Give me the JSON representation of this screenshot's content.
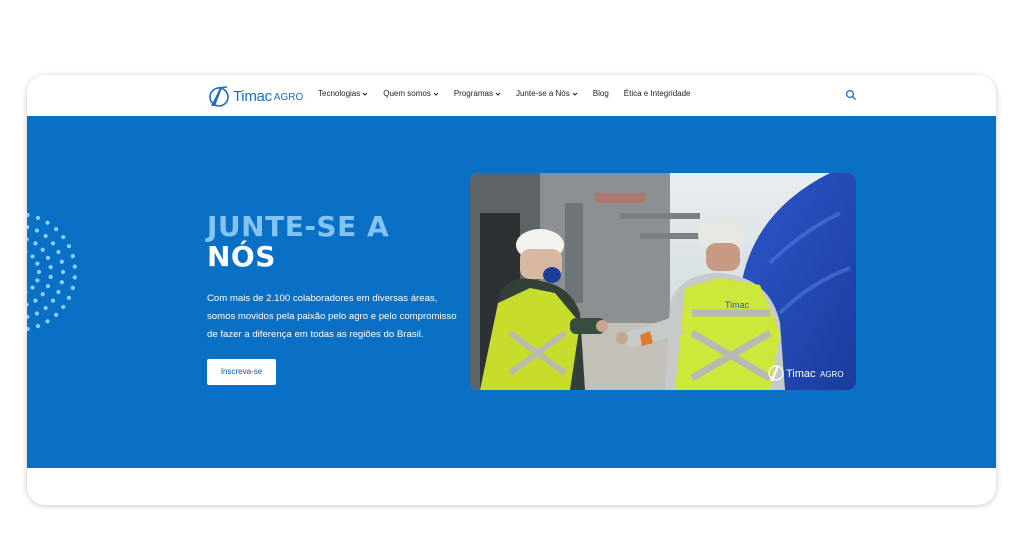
{
  "brand": {
    "name": "Timac",
    "sub": "AGRO",
    "color": "#1a6cc4"
  },
  "nav": {
    "items": [
      {
        "label": "Tecnologias",
        "dropdown": true
      },
      {
        "label": "Quem somos",
        "dropdown": true
      },
      {
        "label": "Programas",
        "dropdown": true
      },
      {
        "label": "Junte-se a Nós",
        "dropdown": true
      },
      {
        "label": "Blog",
        "dropdown": false
      },
      {
        "label": "Ética e Integridade",
        "dropdown": false
      }
    ],
    "search_icon": "search-icon"
  },
  "hero": {
    "title_line1": "JUNTE-SE A",
    "title_line2": "NÓS",
    "description": "Com mais de 2.100 colaboradores em diversas áreas, somos movidos pela paixão pelo agro e pelo compromisso de fazer a diferença em todas as regiões do Brasil.",
    "cta_label": "Inscreva-se",
    "background_color": "#0a70c5",
    "title_accent_color": "#84c4f2"
  },
  "photo": {
    "watermark_name": "Timac",
    "watermark_sub": "AGRO",
    "vest_logo": "Timac"
  }
}
